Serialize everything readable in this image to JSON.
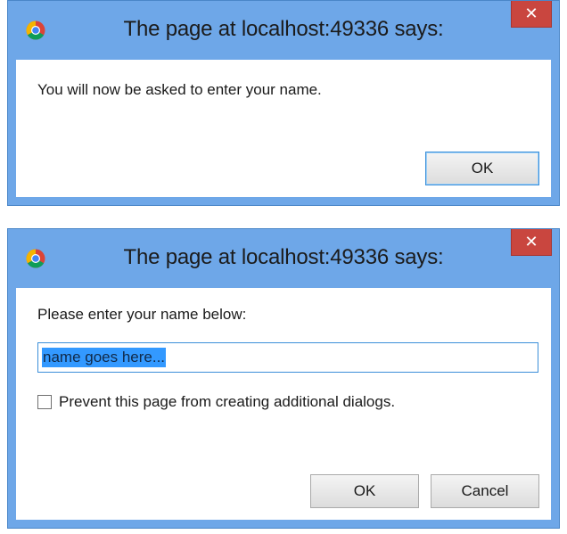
{
  "alert_dialog": {
    "title": "The page at localhost:49336 says:",
    "close_symbol": "✕",
    "message": "You will now be asked to enter your name.",
    "ok_label": "OK"
  },
  "prompt_dialog": {
    "title": "The page at localhost:49336 says:",
    "close_symbol": "✕",
    "message": "Please enter your name below:",
    "input_value": "name goes here...",
    "checkbox_label": "Prevent this page from creating additional dialogs.",
    "checkbox_checked": false,
    "ok_label": "OK",
    "cancel_label": "Cancel"
  },
  "icons": {
    "app_icon": "chrome-icon"
  },
  "colors": {
    "frame": "#6ea7e8",
    "close_button": "#c9463f",
    "selection": "#3399ff"
  }
}
